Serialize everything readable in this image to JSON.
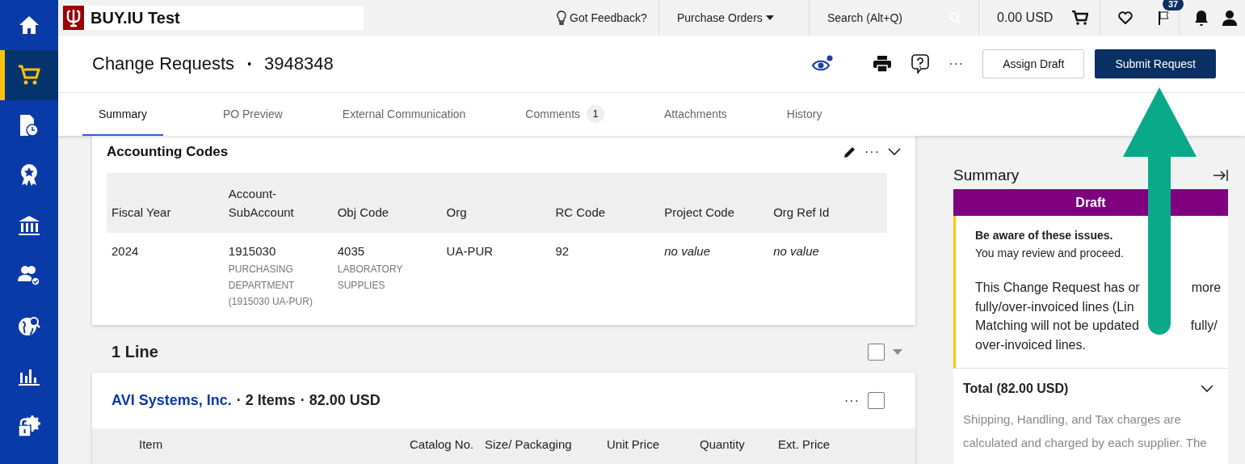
{
  "sidebar": {
    "items": [
      {
        "kind": "home",
        "selected": false
      },
      {
        "kind": "cart",
        "selected": true
      },
      {
        "kind": "document-clock",
        "selected": false
      },
      {
        "kind": "award",
        "selected": false
      },
      {
        "kind": "bank",
        "selected": false
      },
      {
        "kind": "people-check",
        "selected": false
      },
      {
        "kind": "globe-search",
        "selected": false
      },
      {
        "kind": "chart",
        "selected": false
      },
      {
        "kind": "lock-gear",
        "selected": false
      }
    ]
  },
  "topbar": {
    "logo_text": "BUY.IU Test",
    "feedback": "Got Feedback?",
    "menu": "Purchase Orders",
    "search": {
      "placeholder": "Search (Alt+Q)"
    },
    "cart_total": "0.00 USD",
    "flag_count": "37"
  },
  "header": {
    "title": "Change Requests",
    "separator": "•",
    "number": "3948348",
    "more": "···",
    "buttons": [
      {
        "label": "Assign Draft",
        "kind": "secondary"
      },
      {
        "label": "Submit Request",
        "kind": "primary"
      }
    ]
  },
  "tabs": [
    {
      "label": "Summary",
      "selected": true
    },
    {
      "label": "PO Preview",
      "selected": false
    },
    {
      "label": "External Communication",
      "selected": false
    },
    {
      "label": "Comments",
      "selected": false,
      "badge": "1"
    },
    {
      "label": "Attachments",
      "selected": false
    },
    {
      "label": "History",
      "selected": false
    }
  ],
  "accounting_codes": {
    "title": "Accounting Codes",
    "more": "···",
    "columns": [
      "Fiscal Year",
      "Account-SubAccount",
      "Obj Code",
      "Org",
      "RC Code",
      "Project Code",
      "Org Ref Id"
    ],
    "rows": [
      {
        "cells": [
          {
            "value": "2024",
            "kind": "plain"
          },
          {
            "value": "1915030",
            "note": "PURCHASING DEPARTMENT (1915030 UA-PUR)",
            "kind": "plain"
          },
          {
            "value": "4035",
            "note": "LABORATORY SUPPLIES",
            "kind": "plain"
          },
          {
            "value": "UA-PUR",
            "kind": "plain"
          },
          {
            "value": "92",
            "kind": "plain"
          },
          {
            "value": "no value",
            "kind": "empty"
          },
          {
            "value": "no value",
            "kind": "empty"
          }
        ]
      }
    ]
  },
  "lines": {
    "title": "1 Line",
    "checked": false,
    "supplier": {
      "name": "AVI Systems, Inc.",
      "items": "· 2 Items",
      "total": "· 82.00 USD",
      "more": "···",
      "checked": false
    },
    "columns": [
      "Item",
      "Catalog No.",
      "Size/ Packaging",
      "Unit Price",
      "Quantity",
      "Ext. Price"
    ]
  },
  "summary": {
    "title": "Summary",
    "status": "Draft",
    "warning": {
      "title": "Be aware of these issues.",
      "subtitle": "You may review and proceed.",
      "lines": [
        [
          "This Change Request has or",
          "more"
        ],
        [
          "fully/over-invoiced lines (Lin"
        ],
        [
          "Matching will not be updated",
          "fully/"
        ],
        [
          "over-invoiced lines."
        ]
      ]
    },
    "total": {
      "title": "Total (82.00 USD)",
      "lines": [
        "Shipping, Handling, and Tax charges are",
        "calculated and charged by each supplier. The"
      ]
    }
  }
}
